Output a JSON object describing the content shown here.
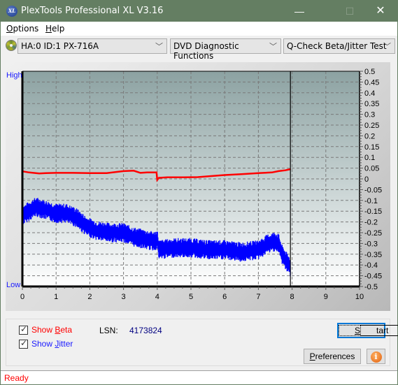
{
  "window": {
    "title": "PlexTools Professional XL V3.16",
    "icon_text": "XL",
    "minimize": "—",
    "maximize": "☐",
    "close": "✕"
  },
  "menu": {
    "options": "Options",
    "options_accel": "O",
    "options_rest": "ptions",
    "help": "Help",
    "help_accel": "H",
    "help_rest": "elp"
  },
  "toolbar": {
    "drive": "HA:0 ID:1  PX-716A",
    "function": "DVD Diagnostic Functions",
    "test": "Q-Check Beta/Jitter Test",
    "chevron": "﹀"
  },
  "controls": {
    "show_beta_prefix": "Show ",
    "show_beta_accel": "B",
    "show_beta_rest": "eta",
    "show_beta_checked": true,
    "show_jitter_prefix": "Show ",
    "show_jitter_accel": "J",
    "show_jitter_rest": "itter",
    "show_jitter_checked": true,
    "lsn_label": "LSN:",
    "lsn_value": "4173824",
    "start_accel": "S",
    "start_rest": "tart",
    "preferences_accel": "P",
    "preferences_rest": "references",
    "info_icon": "i"
  },
  "status": {
    "text": "Ready"
  },
  "colors": {
    "beta": "#ff0000",
    "jitter": "#0000ff",
    "title_bar": "#647e62",
    "label_blue": "#1a1aff",
    "lsn_value": "#000080"
  },
  "chart_data": {
    "type": "line",
    "title": "",
    "xlabel": "",
    "ylabel": "",
    "left_axis_labels": {
      "top": "High",
      "bottom": "Low"
    },
    "xlim": [
      0,
      10
    ],
    "ylim": [
      -0.5,
      0.5
    ],
    "x_ticks": [
      "0",
      "1",
      "2",
      "3",
      "4",
      "5",
      "6",
      "7",
      "8",
      "9",
      "10"
    ],
    "y_ticks": [
      "0.5",
      "0.45",
      "0.4",
      "0.35",
      "0.3",
      "0.25",
      "0.2",
      "0.15",
      "0.1",
      "0.05",
      "0",
      "-0.05",
      "-0.1",
      "-0.15",
      "-0.2",
      "-0.25",
      "-0.3",
      "-0.35",
      "-0.4",
      "-0.45",
      "-0.5"
    ],
    "grid": true,
    "cursor_x": 7.95,
    "series": [
      {
        "name": "Beta",
        "color": "#ff0000",
        "x": [
          0,
          0.2,
          0.5,
          0.7,
          1.0,
          1.5,
          2.0,
          2.5,
          3.0,
          3.3,
          3.5,
          3.7,
          3.98,
          4.0,
          4.05,
          4.3,
          4.8,
          5.2,
          5.6,
          6.0,
          6.5,
          7.0,
          7.4,
          7.6,
          7.8,
          7.95
        ],
        "y": [
          0.035,
          0.03,
          0.025,
          0.027,
          0.028,
          0.028,
          0.027,
          0.027,
          0.036,
          0.038,
          0.028,
          0.03,
          0.03,
          -0.005,
          0.005,
          0.007,
          0.007,
          0.008,
          0.013,
          0.018,
          0.022,
          0.027,
          0.03,
          0.036,
          0.04,
          0.045
        ]
      },
      {
        "name": "Jitter",
        "color": "#0000ff",
        "x": [
          0,
          0.2,
          0.4,
          0.6,
          0.8,
          1.0,
          1.3,
          1.6,
          1.9,
          2.2,
          2.6,
          3.0,
          3.3,
          3.6,
          3.9,
          4.0,
          4.05,
          4.5,
          5.0,
          5.5,
          6.0,
          6.5,
          7.0,
          7.3,
          7.5,
          7.6,
          7.7,
          7.85,
          7.95
        ],
        "y": [
          -0.17,
          -0.15,
          -0.13,
          -0.14,
          -0.15,
          -0.16,
          -0.16,
          -0.18,
          -0.22,
          -0.24,
          -0.25,
          -0.25,
          -0.27,
          -0.28,
          -0.29,
          -0.28,
          -0.33,
          -0.32,
          -0.32,
          -0.33,
          -0.33,
          -0.34,
          -0.33,
          -0.3,
          -0.29,
          -0.3,
          -0.35,
          -0.39,
          -0.41
        ],
        "band": 0.035
      }
    ]
  }
}
